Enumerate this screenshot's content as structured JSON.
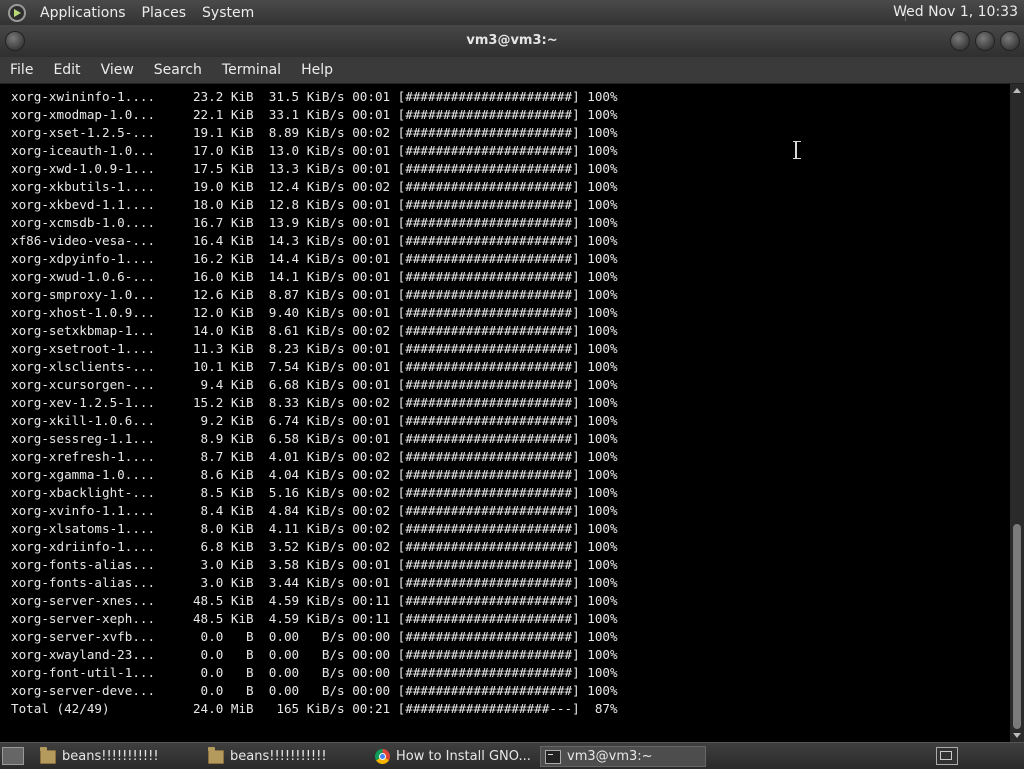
{
  "top_panel": {
    "menus": [
      "Applications",
      "Places",
      "System"
    ],
    "clock": "Wed Nov 1, 10:33"
  },
  "window": {
    "title": "vm3@vm3:~"
  },
  "menubar": {
    "items": [
      "File",
      "Edit",
      "View",
      "Search",
      "Terminal",
      "Help"
    ]
  },
  "terminal": {
    "lines": [
      "xorg-xwininfo-1....     23.2 KiB  31.5 KiB/s 00:01 [######################] 100%",
      "xorg-xmodmap-1.0...     22.1 KiB  33.1 KiB/s 00:01 [######################] 100%",
      "xorg-xset-1.2.5-...     19.1 KiB  8.89 KiB/s 00:02 [######################] 100%",
      "xorg-iceauth-1.0...     17.0 KiB  13.0 KiB/s 00:01 [######################] 100%",
      "xorg-xwd-1.0.9-1...     17.5 KiB  13.3 KiB/s 00:01 [######################] 100%",
      "xorg-xkbutils-1....     19.0 KiB  12.4 KiB/s 00:02 [######################] 100%",
      "xorg-xkbevd-1.1....     18.0 KiB  12.8 KiB/s 00:01 [######################] 100%",
      "xorg-xcmsdb-1.0....     16.7 KiB  13.9 KiB/s 00:01 [######################] 100%",
      "xf86-video-vesa-...     16.4 KiB  14.3 KiB/s 00:01 [######################] 100%",
      "xorg-xdpyinfo-1....     16.2 KiB  14.4 KiB/s 00:01 [######################] 100%",
      "xorg-xwud-1.0.6-...     16.0 KiB  14.1 KiB/s 00:01 [######################] 100%",
      "xorg-smproxy-1.0...     12.6 KiB  8.87 KiB/s 00:01 [######################] 100%",
      "xorg-xhost-1.0.9...     12.0 KiB  9.40 KiB/s 00:01 [######################] 100%",
      "xorg-setxkbmap-1...     14.0 KiB  8.61 KiB/s 00:02 [######################] 100%",
      "xorg-xsetroot-1....     11.3 KiB  8.23 KiB/s 00:01 [######################] 100%",
      "xorg-xlsclients-...     10.1 KiB  7.54 KiB/s 00:01 [######################] 100%",
      "xorg-xcursorgen-...      9.4 KiB  6.68 KiB/s 00:01 [######################] 100%",
      "xorg-xev-1.2.5-1...     15.2 KiB  8.33 KiB/s 00:02 [######################] 100%",
      "xorg-xkill-1.0.6...      9.2 KiB  6.74 KiB/s 00:01 [######################] 100%",
      "xorg-sessreg-1.1...      8.9 KiB  6.58 KiB/s 00:01 [######################] 100%",
      "xorg-xrefresh-1....      8.7 KiB  4.01 KiB/s 00:02 [######################] 100%",
      "xorg-xgamma-1.0....      8.6 KiB  4.04 KiB/s 00:02 [######################] 100%",
      "xorg-xbacklight-...      8.5 KiB  5.16 KiB/s 00:02 [######################] 100%",
      "xorg-xvinfo-1.1....      8.4 KiB  4.84 KiB/s 00:02 [######################] 100%",
      "xorg-xlsatoms-1....      8.0 KiB  4.11 KiB/s 00:02 [######################] 100%",
      "xorg-xdriinfo-1....      6.8 KiB  3.52 KiB/s 00:02 [######################] 100%",
      "xorg-fonts-alias...      3.0 KiB  3.58 KiB/s 00:01 [######################] 100%",
      "xorg-fonts-alias...      3.0 KiB  3.44 KiB/s 00:01 [######################] 100%",
      "xorg-server-xnes...     48.5 KiB  4.59 KiB/s 00:11 [######################] 100%",
      "xorg-server-xeph...     48.5 KiB  4.59 KiB/s 00:11 [######################] 100%",
      "xorg-server-xvfb...      0.0   B  0.00   B/s 00:00 [######################] 100%",
      "xorg-xwayland-23...      0.0   B  0.00   B/s 00:00 [######################] 100%",
      "xorg-font-util-1...      0.0   B  0.00   B/s 00:00 [######################] 100%",
      "xorg-server-deve...      0.0   B  0.00   B/s 00:00 [######################] 100%",
      "Total (42/49)           24.0 MiB   165 KiB/s 00:21 [###################---]  87%"
    ]
  },
  "taskbar": {
    "items": [
      {
        "label": "beans!!!!!!!!!!!",
        "icon": "folder-icon"
      },
      {
        "label": "beans!!!!!!!!!!!",
        "icon": "folder-icon"
      },
      {
        "label": "How to Install GNO...",
        "icon": "chrome-icon"
      },
      {
        "label": "vm3@vm3:~",
        "icon": "terminal-icon",
        "active": true
      }
    ]
  }
}
